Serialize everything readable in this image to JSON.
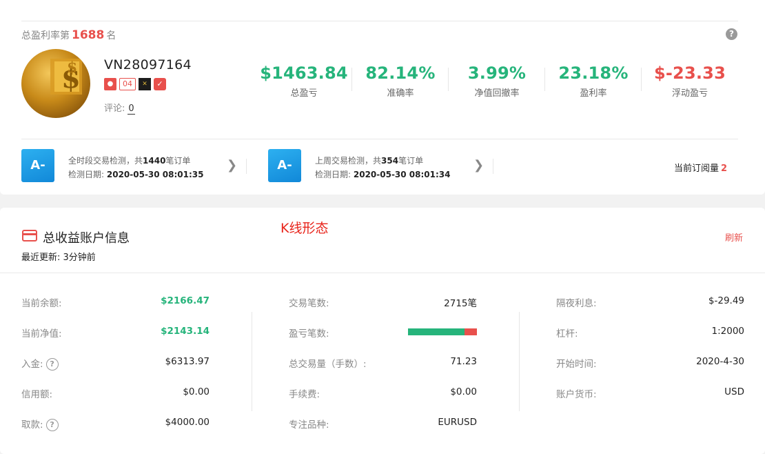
{
  "profile": {
    "rank_prefix": "总盈利率第",
    "rank_number": "1688",
    "rank_suffix": "名",
    "username": "VN28097164",
    "badge_level": "04",
    "comment_label": "评论:",
    "comment_count": "0"
  },
  "stats": [
    {
      "value": "$1463.84",
      "label": "总盈亏",
      "color": "#26b47b"
    },
    {
      "value": "82.14%",
      "label": "准确率",
      "color": "#26b47b"
    },
    {
      "value": "3.99%",
      "label": "净值回撤率",
      "color": "#26b47b"
    },
    {
      "value": "23.18%",
      "label": "盈利率",
      "color": "#26b47b"
    },
    {
      "value": "$-23.33",
      "label": "浮动盈亏",
      "color": "#e8504c"
    }
  ],
  "detections": [
    {
      "grade": "A-",
      "prefix": "全时段交易检测，共",
      "count": "1440",
      "suffix": "笔订单",
      "date_label": "检测日期:",
      "date": "2020-05-30 08:01:35"
    },
    {
      "grade": "A-",
      "prefix": "上周交易检测，共",
      "count": "354",
      "suffix": "笔订单",
      "date_label": "检测日期:",
      "date": "2020-05-30 08:01:34"
    }
  ],
  "subscription": {
    "label": "当前订阅量",
    "count": "2"
  },
  "account": {
    "title": "总收益账户信息",
    "annotation": "K线形态",
    "refresh_label": "刷新",
    "updated_label": "最近更新:",
    "updated_value": "3分钟前",
    "col1": [
      {
        "key": "当前余额:",
        "value": "$2166.47"
      },
      {
        "key": "当前净值:",
        "value": "$2143.14"
      },
      {
        "key": "入金:",
        "value": "$6313.97"
      },
      {
        "key": "信用额:",
        "value": "$0.00"
      },
      {
        "key": "取款:",
        "value": "$4000.00"
      }
    ],
    "col2": [
      {
        "key": "交易笔数:",
        "value": "2715笔"
      },
      {
        "key": "盈亏笔数:",
        "win_fraction": 0.82
      },
      {
        "key": "总交易量（手数）:",
        "value": "71.23"
      },
      {
        "key": "手续费:",
        "value": "$0.00"
      },
      {
        "key": "专注品种:",
        "value": "EURUSD"
      }
    ],
    "col3": [
      {
        "key": "隔夜利息:",
        "value": "$-29.49"
      },
      {
        "key": "杠杆:",
        "value": "1:2000"
      },
      {
        "key": "开始时间:",
        "value": "2020-4-30"
      },
      {
        "key": "账户货币:",
        "value": "USD"
      }
    ]
  },
  "colors": {
    "green": "#26b47b",
    "red": "#e8504c"
  },
  "icons": [
    "help-icon",
    "avatar-dollar-image",
    "follower-icon",
    "broker-logo-icon",
    "shield-verified-icon",
    "chevron-right-icon",
    "card-icon"
  ]
}
